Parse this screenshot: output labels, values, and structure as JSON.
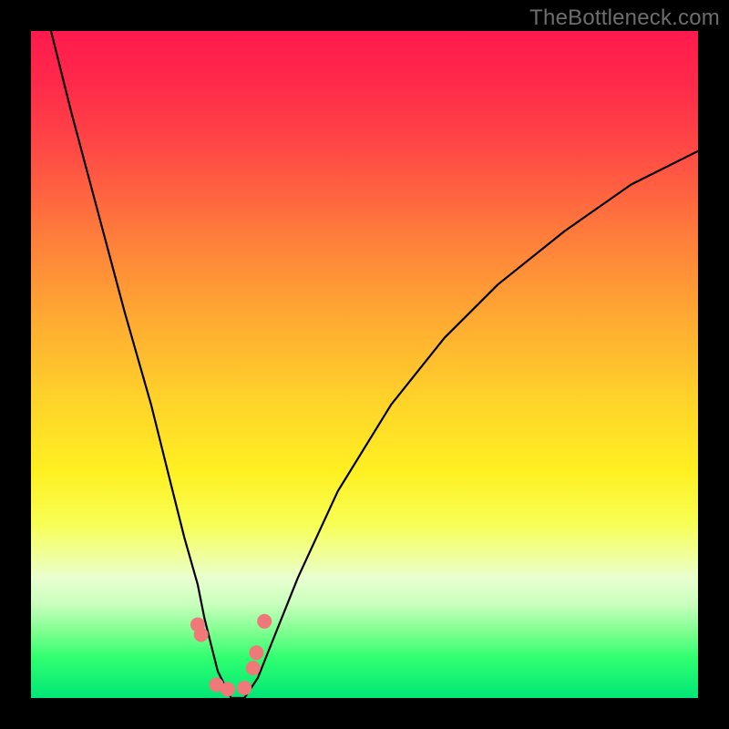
{
  "watermark": "TheBottleneck.com",
  "chart_data": {
    "type": "line",
    "title": "",
    "xlabel": "",
    "ylabel": "",
    "xlim": [
      0,
      100
    ],
    "ylim": [
      0,
      100
    ],
    "grid": false,
    "legend": false,
    "background": "rainbow-vertical",
    "series": [
      {
        "name": "curve",
        "x": [
          3,
          6,
          10,
          14,
          18,
          21,
          23,
          25,
          26,
          27,
          28,
          30,
          31,
          32,
          34,
          36,
          40,
          46,
          54,
          62,
          70,
          80,
          90,
          100
        ],
        "y": [
          100,
          88,
          73,
          58,
          44,
          32,
          24,
          17,
          12,
          8,
          4,
          0,
          0,
          0,
          3,
          8,
          18,
          31,
          44,
          54,
          62,
          70,
          77,
          82
        ]
      }
    ],
    "markers": [
      {
        "name": "marker-left-upper",
        "x": 25.0,
        "y": 11.0
      },
      {
        "name": "marker-left-lower",
        "x": 25.5,
        "y": 9.5
      },
      {
        "name": "marker-floor-a",
        "x": 27.8,
        "y": 2.0
      },
      {
        "name": "marker-floor-b",
        "x": 29.5,
        "y": 1.3
      },
      {
        "name": "marker-floor-c",
        "x": 32.0,
        "y": 1.5
      },
      {
        "name": "marker-right-lower",
        "x": 33.3,
        "y": 4.5
      },
      {
        "name": "marker-right-mid",
        "x": 33.8,
        "y": 6.8
      },
      {
        "name": "marker-right-upper",
        "x": 35.0,
        "y": 11.5
      }
    ]
  }
}
